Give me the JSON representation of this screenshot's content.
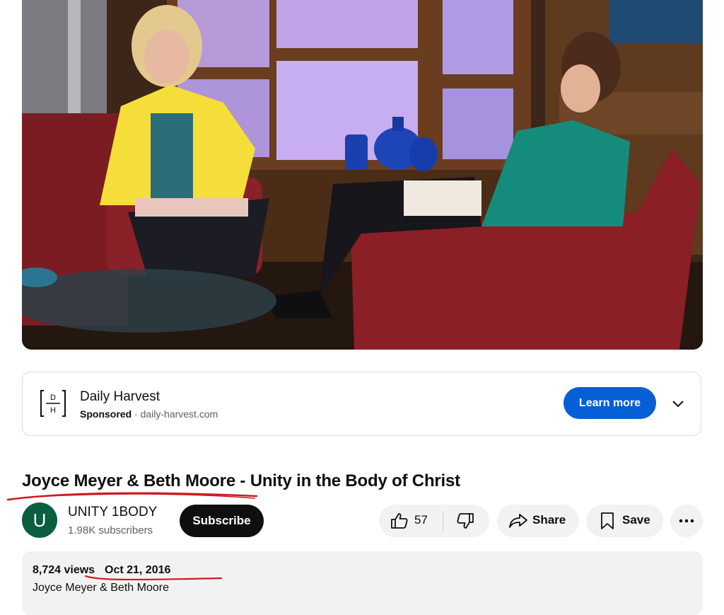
{
  "video": {
    "scene": "video-frame"
  },
  "ad": {
    "logo_letters_top": "D",
    "logo_letters_bottom": "H",
    "name": "Daily Harvest",
    "sponsored_label": "Sponsored",
    "separator": " · ",
    "domain": "daily-harvest.com",
    "cta_label": "Learn more",
    "expand_icon": "chevron-down-icon",
    "cta_color": "#065fd4"
  },
  "video_info": {
    "title": "Joyce Meyer & Beth Moore - Unity in the Body of Christ",
    "channel": {
      "avatar_letter": "U",
      "avatar_color": "#0b5e3f",
      "name": "UNITY 1BODY",
      "subscribers": "1.98K subscribers"
    },
    "subscribe_label": "Subscribe",
    "actions": {
      "like_count": "57",
      "like_icon": "thumbs-up-icon",
      "dislike_icon": "thumbs-down-icon",
      "share_label": "Share",
      "share_icon": "share-arrow-icon",
      "save_label": "Save",
      "save_icon": "bookmark-icon",
      "more_icon": "more-horizontal-icon"
    },
    "description": {
      "views": "8,724 views",
      "date": "Oct 21, 2016",
      "text": "Joyce Meyer & Beth Moore"
    }
  },
  "annotation_color": "#d0191e"
}
